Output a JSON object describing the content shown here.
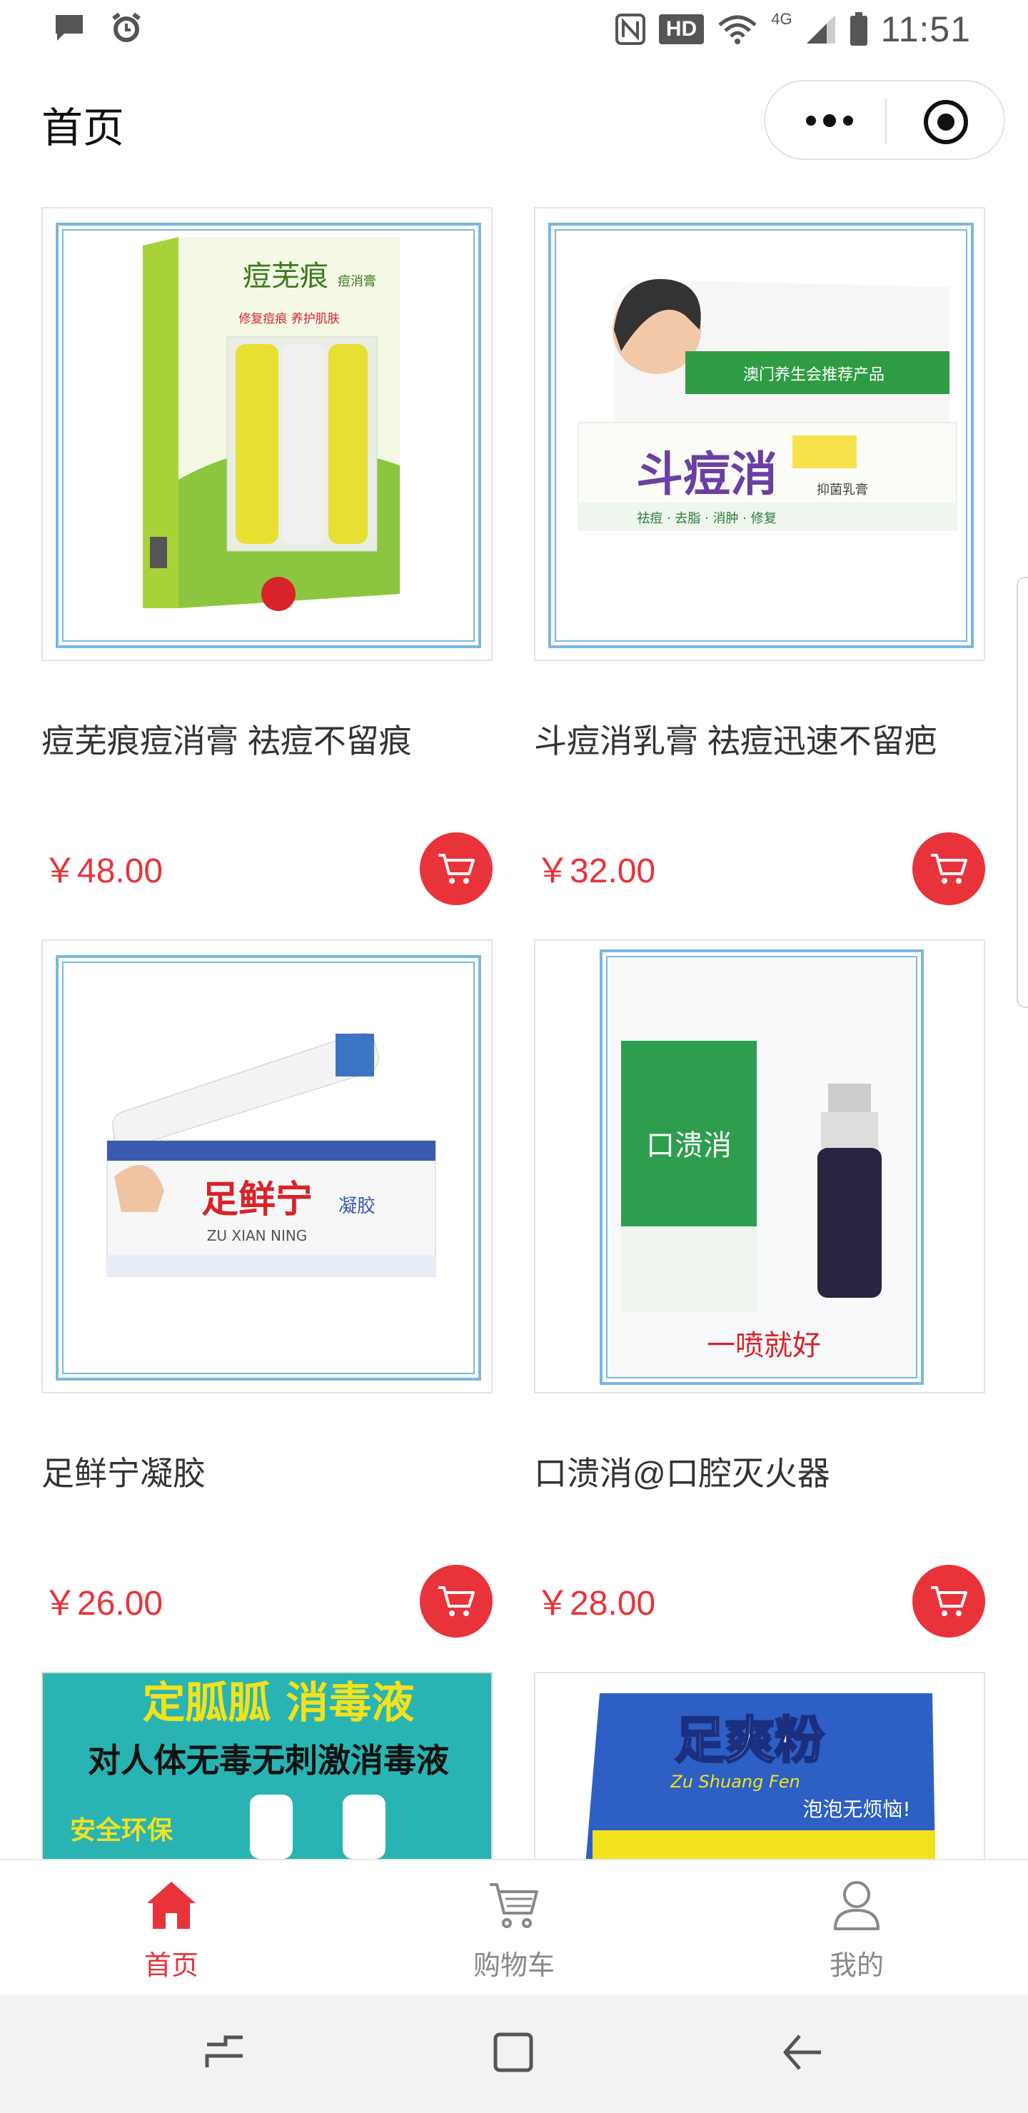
{
  "statusbar": {
    "time": "11:51",
    "hd": "HD",
    "network": "4G"
  },
  "navbar": {
    "title": "首页"
  },
  "products": [
    {
      "name": "痘芜痕痘消膏 祛痘不留痕",
      "price": "￥48.00",
      "box_text": "痘芜痕",
      "box_sub": "痘消膏",
      "box_tag": "修复痘痕 养护肌肤"
    },
    {
      "name": "斗痘消乳膏 祛痘迅速不留疤",
      "price": "￥32.00",
      "box_text": "斗痘消",
      "box_sub": "抑菌乳膏",
      "box_tag": "澳门养生会推荐产品",
      "box_tag2": "祛痘 · 去脂 · 消肿 · 修复"
    },
    {
      "name": "足鲜宁凝胶",
      "price": "￥26.00",
      "box_text": "足鲜宁",
      "box_sub": "凝胶",
      "box_tag": "ZU XIAN NING"
    },
    {
      "name": "口溃消@口腔灭火器",
      "price": "￥28.00",
      "box_text": "口溃消",
      "box_sub": "一喷就好"
    },
    {
      "name": "",
      "price": "",
      "box_text": "定胍胍 消毒液",
      "box_sub": "对人体无毒无刺激消毒液",
      "box_tag": "安全环保"
    },
    {
      "name": "",
      "price": "",
      "box_text": "足爽粉",
      "box_sub": "Zu Shuang Fen",
      "box_tag": "泡泡无烦恼!"
    }
  ],
  "tabbar": {
    "tabs": [
      {
        "label": "首页",
        "icon": "home-icon",
        "active": true
      },
      {
        "label": "购物车",
        "icon": "cart-icon",
        "active": false
      },
      {
        "label": "我的",
        "icon": "user-icon",
        "active": false
      }
    ]
  },
  "colors": {
    "accent": "#e8333a",
    "text": "#333333",
    "muted": "#888888"
  }
}
